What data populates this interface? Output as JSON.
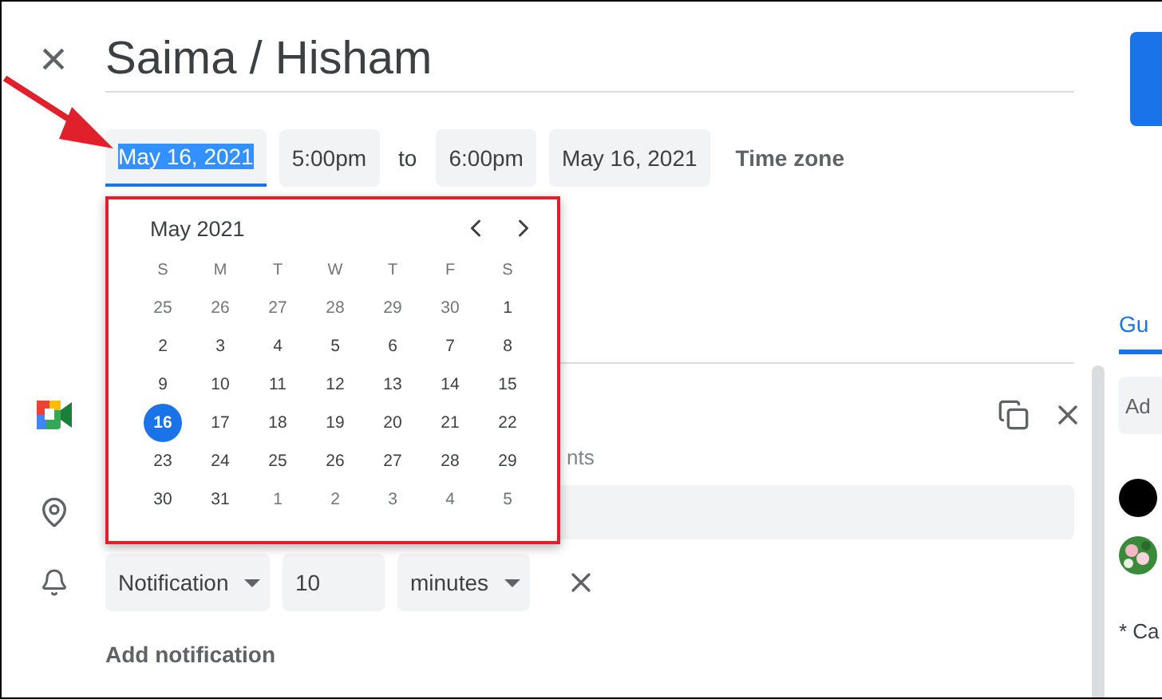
{
  "close_label": "×",
  "title": "Saima / Hisham",
  "date_row": {
    "start_date": {
      "value": "May 16, 2021",
      "focused": true
    },
    "start_time": "5:00pm",
    "separator": "to",
    "end_time": "6:00pm",
    "end_date": "May 16, 2021",
    "time_zone": "Time zone"
  },
  "date_picker": {
    "month": "May 2021",
    "weekdays": [
      "S",
      "M",
      "T",
      "W",
      "T",
      "F",
      "S"
    ],
    "weeks": [
      [
        {
          "day": "25",
          "muted": true,
          "selected": false
        },
        {
          "day": "26",
          "muted": true,
          "selected": false
        },
        {
          "day": "27",
          "muted": true,
          "selected": false
        },
        {
          "day": "28",
          "muted": true,
          "selected": false
        },
        {
          "day": "29",
          "muted": true,
          "selected": false
        },
        {
          "day": "30",
          "muted": true,
          "selected": false
        },
        {
          "day": "1",
          "muted": false,
          "selected": false
        }
      ],
      [
        {
          "day": "2",
          "muted": false,
          "selected": false
        },
        {
          "day": "3",
          "muted": false,
          "selected": false
        },
        {
          "day": "4",
          "muted": false,
          "selected": false
        },
        {
          "day": "5",
          "muted": false,
          "selected": false
        },
        {
          "day": "6",
          "muted": false,
          "selected": false
        },
        {
          "day": "7",
          "muted": false,
          "selected": false
        },
        {
          "day": "8",
          "muted": false,
          "selected": false
        }
      ],
      [
        {
          "day": "9",
          "muted": false,
          "selected": false
        },
        {
          "day": "10",
          "muted": false,
          "selected": false
        },
        {
          "day": "11",
          "muted": false,
          "selected": false
        },
        {
          "day": "12",
          "muted": false,
          "selected": false
        },
        {
          "day": "13",
          "muted": false,
          "selected": false
        },
        {
          "day": "14",
          "muted": false,
          "selected": false
        },
        {
          "day": "15",
          "muted": false,
          "selected": false
        }
      ],
      [
        {
          "day": "16",
          "muted": false,
          "selected": true
        },
        {
          "day": "17",
          "muted": false,
          "selected": false
        },
        {
          "day": "18",
          "muted": false,
          "selected": false
        },
        {
          "day": "19",
          "muted": false,
          "selected": false
        },
        {
          "day": "20",
          "muted": false,
          "selected": false
        },
        {
          "day": "21",
          "muted": false,
          "selected": false
        },
        {
          "day": "22",
          "muted": false,
          "selected": false
        }
      ],
      [
        {
          "day": "23",
          "muted": false,
          "selected": false
        },
        {
          "day": "24",
          "muted": false,
          "selected": false
        },
        {
          "day": "25",
          "muted": false,
          "selected": false
        },
        {
          "day": "26",
          "muted": false,
          "selected": false
        },
        {
          "day": "27",
          "muted": false,
          "selected": false
        },
        {
          "day": "28",
          "muted": false,
          "selected": false
        },
        {
          "day": "29",
          "muted": false,
          "selected": false
        }
      ],
      [
        {
          "day": "30",
          "muted": false,
          "selected": false
        },
        {
          "day": "31",
          "muted": false,
          "selected": false
        },
        {
          "day": "1",
          "muted": true,
          "selected": false
        },
        {
          "day": "2",
          "muted": true,
          "selected": false
        },
        {
          "day": "3",
          "muted": true,
          "selected": false
        },
        {
          "day": "4",
          "muted": true,
          "selected": false
        },
        {
          "day": "5",
          "muted": true,
          "selected": false
        }
      ]
    ]
  },
  "conference": {
    "partial_text": "nts"
  },
  "notification": {
    "type": "Notification",
    "amount": "10",
    "unit": "minutes"
  },
  "add_notification": "Add notification",
  "right_panel": {
    "tab": {
      "label": "Gu",
      "selected": true
    },
    "guest_field": {
      "placeholder": "Ad"
    },
    "note": "* Ca"
  }
}
